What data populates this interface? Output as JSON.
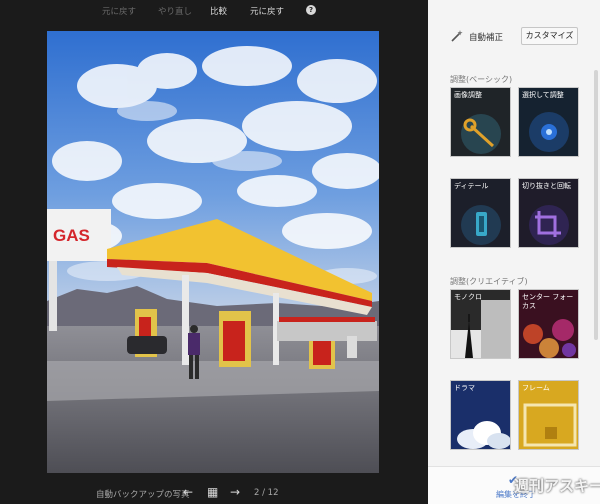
{
  "toolbar": {
    "undo_label": "元に戻す",
    "redo_label": "やり直し",
    "compare_label": "比較",
    "revert_label": "元に戻す",
    "help_glyph": "?"
  },
  "footer": {
    "album_label": "自動バックアップの写真",
    "prev_glyph": "←",
    "grid_glyph": "▦",
    "next_glyph": "→",
    "counter": "2 / 12"
  },
  "photo": {
    "sign_text": "GAS",
    "sign_color": "#d4262c",
    "canopy_color": "#f2c230"
  },
  "panel": {
    "auto_fix_label": "自動補正",
    "customize_label": "カスタマイズ",
    "basic_section": "調整(ベーシック)",
    "creative_section": "調整(クリエイティブ)",
    "basic_tiles": [
      {
        "label": "画像調整",
        "icon": "wrench-icon"
      },
      {
        "label": "選択して調整",
        "icon": "target-icon"
      },
      {
        "label": "ディテール",
        "icon": "sharpen-icon"
      },
      {
        "label": "切り抜きと回転",
        "icon": "crop-icon"
      }
    ],
    "creative_tiles": [
      {
        "label": "モノクロ",
        "icon": "eiffel-icon"
      },
      {
        "label": "センター フォーカス",
        "icon": "bokeh-icon"
      },
      {
        "label": "ドラマ",
        "icon": "cloud-icon"
      },
      {
        "label": "フレーム",
        "icon": "frame-icon"
      }
    ],
    "finish_label": "編集を終了",
    "watermark": "週刊アスキー"
  }
}
